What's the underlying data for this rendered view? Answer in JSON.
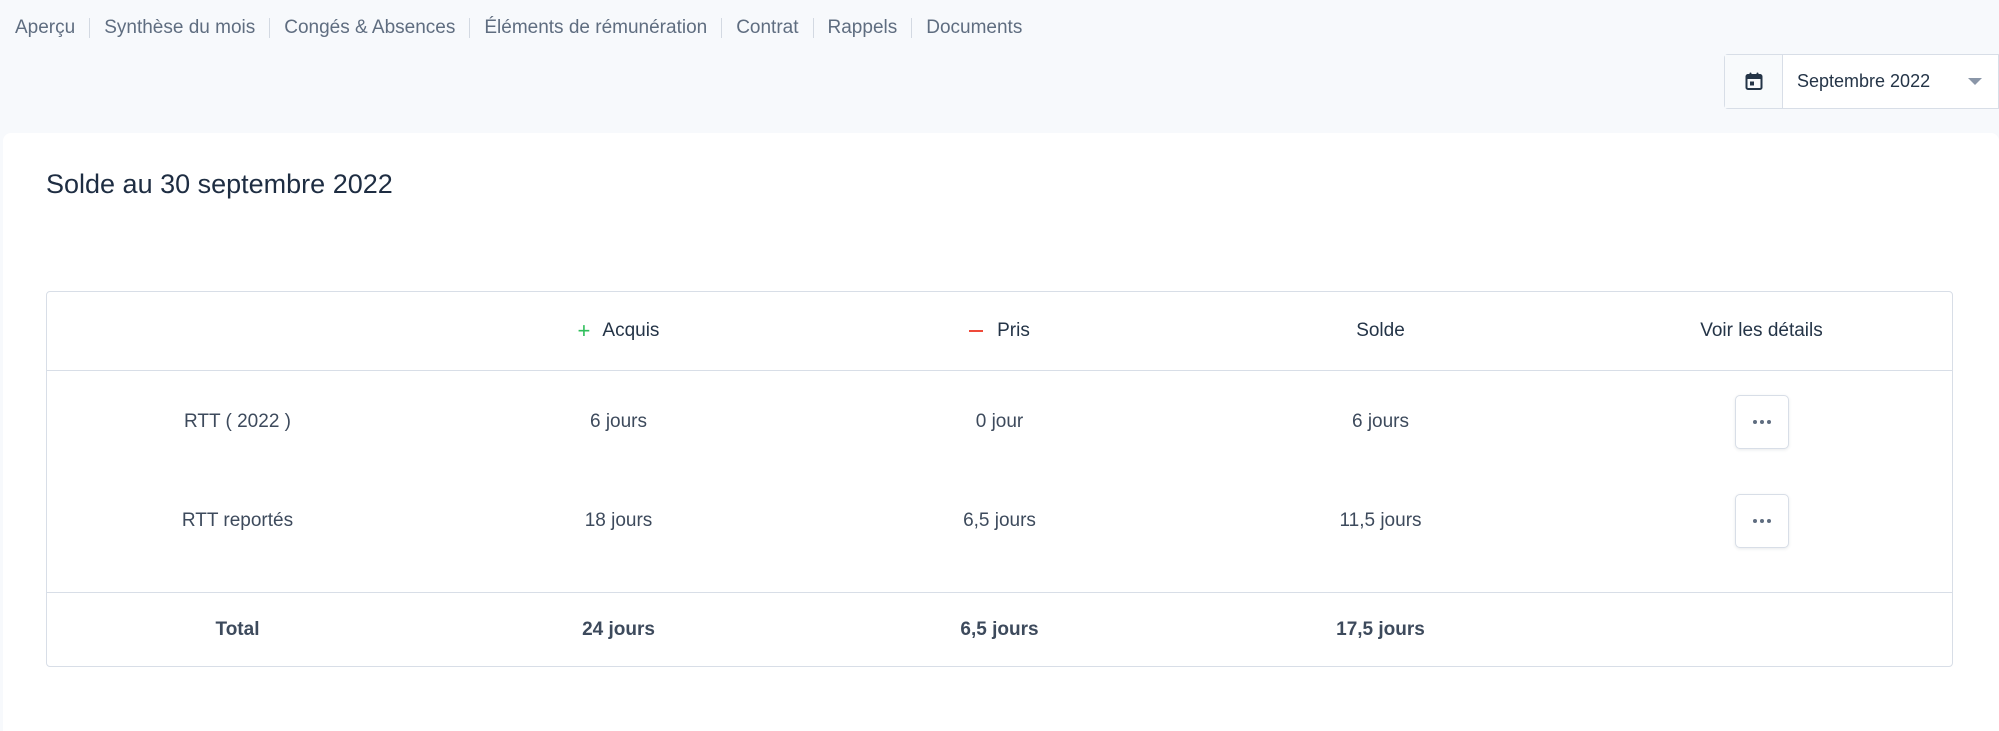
{
  "nav": {
    "tabs": [
      "Aperçu",
      "Synthèse du mois",
      "Congés & Absences",
      "Éléments de rémunération",
      "Contrat",
      "Rappels",
      "Documents"
    ]
  },
  "month_picker": {
    "value": "Septembre 2022",
    "icon": "calendar-icon"
  },
  "card": {
    "title": "Solde au 30 septembre 2022"
  },
  "table": {
    "headers": {
      "type": "",
      "acquired": "Acquis",
      "taken": "Pris",
      "balance": "Solde",
      "details": "Voir les détails"
    },
    "rows": [
      {
        "label": "RTT ( 2022 )",
        "acquired": "6 jours",
        "taken": "0 jour",
        "balance": "6 jours"
      },
      {
        "label": "RTT reportés",
        "acquired": "18 jours",
        "taken": "6,5 jours",
        "balance": "11,5 jours"
      }
    ],
    "total": {
      "label": "Total",
      "acquired": "24 jours",
      "taken": "6,5 jours",
      "balance": "17,5 jours"
    }
  },
  "colors": {
    "plus": "#2fbf5b",
    "minus": "#ef4a3a",
    "border": "#d8dee7",
    "background": "#f7f9fc"
  }
}
